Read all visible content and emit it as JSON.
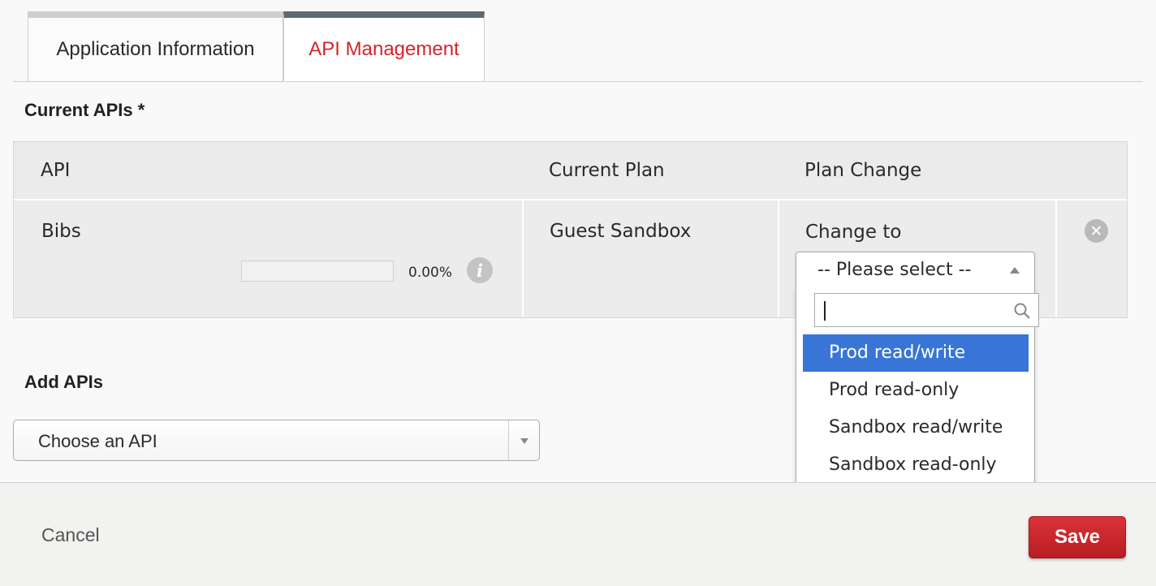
{
  "tabs": [
    {
      "label": "Application Information",
      "active": false
    },
    {
      "label": "API Management",
      "active": true
    }
  ],
  "current_apis": {
    "title": "Current APIs *",
    "columns": [
      "API",
      "Current Plan",
      "Plan Change"
    ],
    "rows": [
      {
        "api": "Bibs",
        "usage_percent": "0.00%",
        "usage_fraction": 0.0,
        "current_plan": "Guest Sandbox",
        "plan_change_label": "Change to",
        "plan_select_value": "-- Please select --",
        "info_icon": "info-icon",
        "remove_icon": "close-circle-icon"
      }
    ]
  },
  "plan_dropdown": {
    "search_value": "",
    "search_icon": "search-icon",
    "options": [
      "Prod read/write",
      "Prod read-only",
      "Sandbox read/write",
      "Sandbox read-only"
    ],
    "highlighted": "Prod read/write"
  },
  "add_apis": {
    "title": "Add APIs",
    "select_value": "Choose an API"
  },
  "footer": {
    "cancel_label": "Cancel",
    "save_label": "Save"
  },
  "colors": {
    "active_tab_text": "#d0262c",
    "active_tab_border": "#5c6b73",
    "highlight": "#3875d7",
    "save_button": "#c9252b"
  }
}
